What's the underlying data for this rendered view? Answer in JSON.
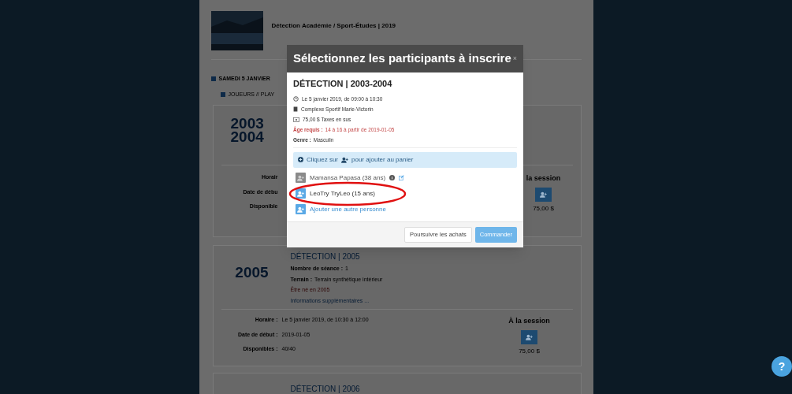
{
  "page": {
    "header": {
      "title": "Détection Académie / Sport-Études | 2019"
    },
    "day": "SAMEDI 5 JANVIER",
    "group": "JOUEURS // PLAY",
    "sessions": [
      {
        "year": [
          "2003",
          "2004"
        ],
        "labels": [
          "Horair",
          "Date de débu",
          "Disponible"
        ],
        "price_heading": "la session",
        "price": "75,00 $"
      },
      {
        "year": [
          "2005"
        ],
        "title": "DÉTECTION | 2005",
        "facts": [
          {
            "label": "Nombre de séance :",
            "value": "1"
          },
          {
            "label": "Terrain :",
            "value": "Terrain synthétique intérieur"
          }
        ],
        "requirement": "Être né en 2005",
        "more": "Informations supplémentaires ...",
        "rows": [
          {
            "label": "Horaire :",
            "value": "Le 5 janvier 2019, de 10:30 à 12:00"
          },
          {
            "label": "Date de début :",
            "value": "2019-01-05"
          },
          {
            "label": "Disponibles :",
            "value": "40/40"
          }
        ],
        "price_heading": "À la session",
        "price": "75,00 $"
      },
      {
        "title": "DÉTECTION | 2006"
      }
    ]
  },
  "modal": {
    "title": "Sélectionnez les participants à inscrire",
    "close": "×",
    "event": "DÉTECTION | 2003-2004",
    "details": [
      {
        "kind": "clock",
        "text": "Le 5 janvier 2019, de 09:00 à 10:30"
      },
      {
        "kind": "building",
        "text": "Complexe Sportif Marie-Victorin"
      },
      {
        "kind": "money",
        "text": "75,00 $ Taxes en sus"
      }
    ],
    "age": {
      "label": "Âge requis :",
      "value": "14 à 16 à partir de 2019-01-05"
    },
    "gender": {
      "label": "Genre :",
      "value": "Masculin"
    },
    "hint": {
      "before": "Cliquez sur",
      "after": "pour ajouter au panier"
    },
    "participants": [
      {
        "kind": "person",
        "name": "Mamansa Papasa (38 ans)",
        "disabled": true,
        "highlighted": false
      },
      {
        "kind": "person",
        "name": "LeoTry TryLeo (15 ans)",
        "disabled": false,
        "highlighted": true
      },
      {
        "kind": "add",
        "name": "Ajouter une autre personne",
        "disabled": false,
        "highlighted": false
      }
    ],
    "buttons": [
      {
        "label": "Poursuivre les achats",
        "kind": "secondary"
      },
      {
        "label": "Commander",
        "kind": "primary"
      }
    ]
  },
  "help": "?"
}
